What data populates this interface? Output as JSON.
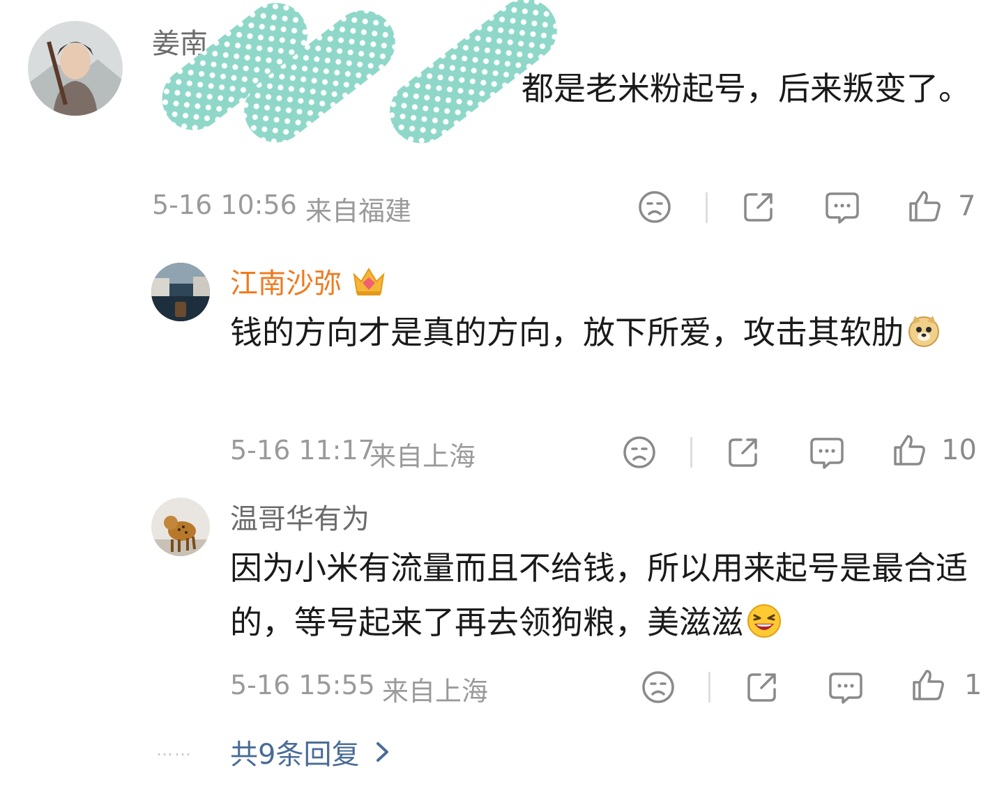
{
  "comment": {
    "name": "姜南",
    "text": "都是老米粉起号，后来叛变了。",
    "time": "5-16 10:56",
    "location": "来自福建",
    "likes": "7"
  },
  "replies": [
    {
      "name": "江南沙弥",
      "badge": "crown-icon",
      "text": "钱的方向才是真的方向，放下所爱，攻击其软肋",
      "emoji": "doge-emoji",
      "time": "5-16 11:17",
      "location": "来自上海",
      "likes": "10"
    },
    {
      "name": "温哥华有为",
      "text": "因为小米有流量而且不给钱，所以用来起号是最合适的，等号起来了再去领狗粮，美滋滋",
      "emoji": "laugh-emoji",
      "time": "5-16 15:55",
      "location": "来自上海",
      "likes": "1"
    }
  ],
  "more_replies": "共9条回复",
  "colors": {
    "name": "#6b6b6b",
    "vip_name": "#f07a1e",
    "meta": "#9a9a9a",
    "link": "#4a6c96",
    "redaction": "#8fd8c9"
  },
  "icons": [
    "dislike-icon",
    "share-icon",
    "comment-icon",
    "thumbs-up-icon",
    "chevron-right-icon"
  ]
}
